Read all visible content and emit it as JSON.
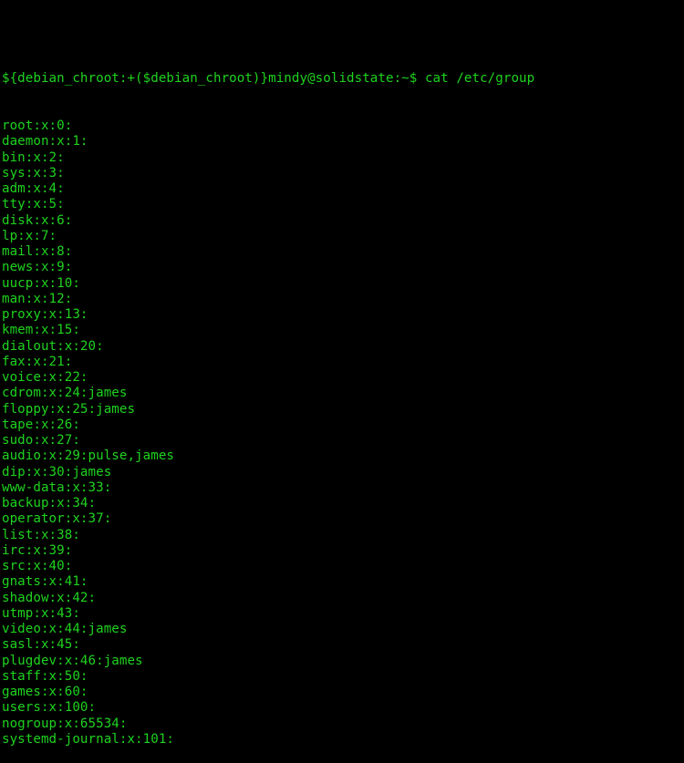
{
  "terminal": {
    "text_color": "#1fd31f",
    "background": "#000000",
    "partial_top_line": "                                                                                  ",
    "prompt": "${debian_chroot:+($debian_chroot)}mindy@solidstate:~$ ",
    "command": "cat /etc/group",
    "output_lines": [
      "root:x:0:",
      "daemon:x:1:",
      "bin:x:2:",
      "sys:x:3:",
      "adm:x:4:",
      "tty:x:5:",
      "disk:x:6:",
      "lp:x:7:",
      "mail:x:8:",
      "news:x:9:",
      "uucp:x:10:",
      "man:x:12:",
      "proxy:x:13:",
      "kmem:x:15:",
      "dialout:x:20:",
      "fax:x:21:",
      "voice:x:22:",
      "cdrom:x:24:james",
      "floppy:x:25:james",
      "tape:x:26:",
      "sudo:x:27:",
      "audio:x:29:pulse,james",
      "dip:x:30:james",
      "www-data:x:33:",
      "backup:x:34:",
      "operator:x:37:",
      "list:x:38:",
      "irc:x:39:",
      "src:x:40:",
      "gnats:x:41:",
      "shadow:x:42:",
      "utmp:x:43:",
      "video:x:44:james",
      "sasl:x:45:",
      "plugdev:x:46:james",
      "staff:x:50:",
      "games:x:60:",
      "users:x:100:",
      "nogroup:x:65534:",
      "systemd-journal:x:101:"
    ]
  }
}
